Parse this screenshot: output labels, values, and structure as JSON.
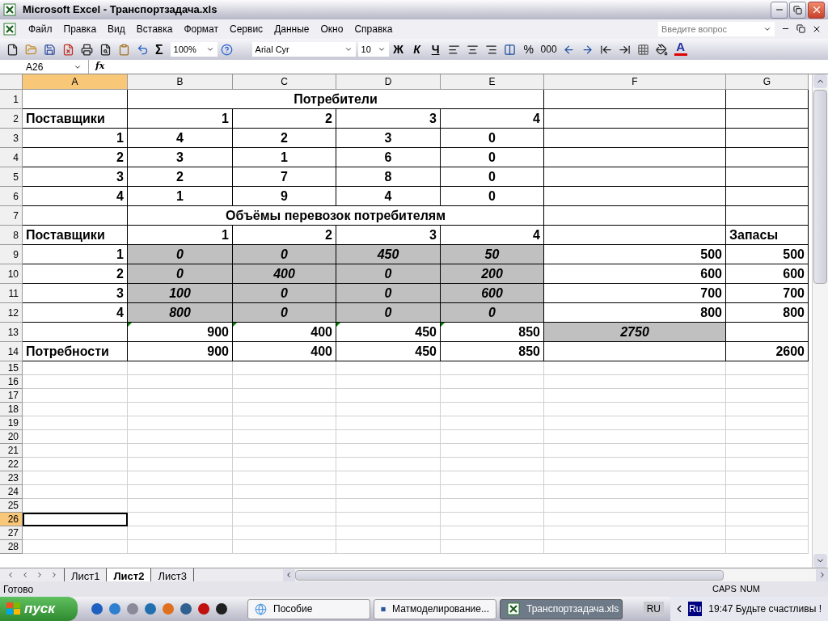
{
  "window": {
    "title": "Microsoft Excel - Транспортзадача.xls"
  },
  "menu": [
    "Файл",
    "Правка",
    "Вид",
    "Вставка",
    "Формат",
    "Сервис",
    "Данные",
    "Окно",
    "Справка"
  ],
  "help_box": {
    "placeholder": "Введите вопрос"
  },
  "toolbar": {
    "zoom": "100%",
    "sum": "Σ",
    "font": "Arial Cyr",
    "size": "10",
    "bold": "Ж",
    "italic": "К",
    "underline": "Ч",
    "percent": "%",
    "thousands": "000",
    "font_color": "A"
  },
  "formula_bar": {
    "name_box": "A26",
    "fx": "fx"
  },
  "columns": [
    {
      "label": "A",
      "selected": true
    },
    {
      "label": "B",
      "selected": false
    },
    {
      "label": "C",
      "selected": false
    },
    {
      "label": "D",
      "selected": false
    },
    {
      "label": "E",
      "selected": false
    },
    {
      "label": "F",
      "selected": false
    },
    {
      "label": "G",
      "selected": false
    }
  ],
  "rows": [
    {
      "label": "1",
      "selected": false,
      "kind": "banner",
      "cells": [
        {
          "kind": "blank"
        },
        {
          "text": "Потребители",
          "kind": "centered"
        },
        {
          "kind": "blank"
        },
        {
          "kind": "blank"
        }
      ]
    },
    {
      "label": "2",
      "selected": false,
      "kind": "table",
      "cells": [
        {
          "text": "Поставщики",
          "kind": "label"
        },
        {
          "text": "1",
          "kind": "number"
        },
        {
          "text": "2",
          "kind": "number"
        },
        {
          "text": "3",
          "kind": "number"
        },
        {
          "text": "4",
          "kind": "number"
        },
        {
          "kind": "blank"
        },
        {
          "kind": "blank"
        }
      ]
    },
    {
      "label": "3",
      "selected": false,
      "kind": "table",
      "cells": [
        {
          "text": "1",
          "kind": "number"
        },
        {
          "text": "4",
          "kind": "centered"
        },
        {
          "text": "2",
          "kind": "centered"
        },
        {
          "text": "3",
          "kind": "centered"
        },
        {
          "text": "0",
          "kind": "centered"
        },
        {
          "kind": "blank"
        },
        {
          "kind": "blank"
        }
      ]
    },
    {
      "label": "4",
      "selected": false,
      "kind": "table",
      "cells": [
        {
          "text": "2",
          "kind": "number"
        },
        {
          "text": "3",
          "kind": "centered"
        },
        {
          "text": "1",
          "kind": "centered"
        },
        {
          "text": "6",
          "kind": "centered"
        },
        {
          "text": "0",
          "kind": "centered"
        },
        {
          "kind": "blank"
        },
        {
          "kind": "blank"
        }
      ]
    },
    {
      "label": "5",
      "selected": false,
      "kind": "table",
      "cells": [
        {
          "text": "3",
          "kind": "number"
        },
        {
          "text": "2",
          "kind": "centered"
        },
        {
          "text": "7",
          "kind": "centered"
        },
        {
          "text": "8",
          "kind": "centered"
        },
        {
          "text": "0",
          "kind": "centered"
        },
        {
          "kind": "blank"
        },
        {
          "kind": "blank"
        }
      ]
    },
    {
      "label": "6",
      "selected": false,
      "kind": "table",
      "cells": [
        {
          "text": "4",
          "kind": "number"
        },
        {
          "text": "1",
          "kind": "centered"
        },
        {
          "text": "9",
          "kind": "centered"
        },
        {
          "text": "4",
          "kind": "centered"
        },
        {
          "text": "0",
          "kind": "centered"
        },
        {
          "kind": "blank"
        },
        {
          "kind": "blank"
        }
      ]
    },
    {
      "label": "7",
      "selected": false,
      "kind": "banner",
      "cells": [
        {
          "kind": "blank"
        },
        {
          "text": "Объёмы перевозок потребителям",
          "kind": "centered"
        },
        {
          "kind": "blank"
        },
        {
          "kind": "blank"
        }
      ]
    },
    {
      "label": "8",
      "selected": false,
      "kind": "table",
      "cells": [
        {
          "text": "Поставщики",
          "kind": "label"
        },
        {
          "text": "1",
          "kind": "number"
        },
        {
          "text": "2",
          "kind": "number"
        },
        {
          "text": "3",
          "kind": "number"
        },
        {
          "text": "4",
          "kind": "number"
        },
        {
          "kind": "blank"
        },
        {
          "text": "Запасы",
          "kind": "label"
        }
      ]
    },
    {
      "label": "9",
      "selected": false,
      "kind": "table",
      "cells": [
        {
          "text": "1",
          "kind": "number"
        },
        {
          "text": "0",
          "kind": "shaded"
        },
        {
          "text": "0",
          "kind": "shaded"
        },
        {
          "text": "450",
          "kind": "shaded"
        },
        {
          "text": "50",
          "kind": "shaded"
        },
        {
          "text": "500",
          "kind": "number"
        },
        {
          "text": "500",
          "kind": "number"
        }
      ]
    },
    {
      "label": "10",
      "selected": false,
      "kind": "table",
      "cells": [
        {
          "text": "2",
          "kind": "number"
        },
        {
          "text": "0",
          "kind": "shaded"
        },
        {
          "text": "400",
          "kind": "shaded"
        },
        {
          "text": "0",
          "kind": "shaded"
        },
        {
          "text": "200",
          "kind": "shaded"
        },
        {
          "text": "600",
          "kind": "number"
        },
        {
          "text": "600",
          "kind": "number"
        }
      ]
    },
    {
      "label": "11",
      "selected": false,
      "kind": "table",
      "cells": [
        {
          "text": "3",
          "kind": "number"
        },
        {
          "text": "100",
          "kind": "shaded"
        },
        {
          "text": "0",
          "kind": "shaded"
        },
        {
          "text": "0",
          "kind": "shaded"
        },
        {
          "text": "600",
          "kind": "shaded"
        },
        {
          "text": "700",
          "kind": "number"
        },
        {
          "text": "700",
          "kind": "number"
        }
      ]
    },
    {
      "label": "12",
      "selected": false,
      "kind": "table",
      "cells": [
        {
          "text": "4",
          "kind": "number"
        },
        {
          "text": "800",
          "kind": "shaded"
        },
        {
          "text": "0",
          "kind": "shaded"
        },
        {
          "text": "0",
          "kind": "shaded"
        },
        {
          "text": "0",
          "kind": "shaded"
        },
        {
          "text": "800",
          "kind": "number"
        },
        {
          "text": "800",
          "kind": "number"
        }
      ]
    },
    {
      "label": "13",
      "selected": false,
      "kind": "table",
      "cells": [
        {
          "kind": "blank"
        },
        {
          "text": "900",
          "kind": "number",
          "error_marker": true
        },
        {
          "text": "400",
          "kind": "number",
          "error_marker": true
        },
        {
          "text": "450",
          "kind": "number",
          "error_marker": true
        },
        {
          "text": "850",
          "kind": "number",
          "error_marker": true
        },
        {
          "text": "2750",
          "kind": "shaded"
        },
        {
          "kind": "blank"
        }
      ]
    },
    {
      "label": "14",
      "selected": false,
      "kind": "table",
      "cells": [
        {
          "text": "Потребности",
          "kind": "label"
        },
        {
          "text": "900",
          "kind": "number"
        },
        {
          "text": "400",
          "kind": "number"
        },
        {
          "text": "450",
          "kind": "number"
        },
        {
          "text": "850",
          "kind": "number"
        },
        {
          "kind": "blank"
        },
        {
          "text": "2600",
          "kind": "number"
        }
      ]
    },
    {
      "label": "15",
      "selected": false,
      "kind": "empty"
    },
    {
      "label": "16",
      "selected": false,
      "kind": "empty"
    },
    {
      "label": "17",
      "selected": false,
      "kind": "empty"
    },
    {
      "label": "18",
      "selected": false,
      "kind": "empty"
    },
    {
      "label": "19",
      "selected": false,
      "kind": "empty"
    },
    {
      "label": "20",
      "selected": false,
      "kind": "empty"
    },
    {
      "label": "21",
      "selected": false,
      "kind": "empty"
    },
    {
      "label": "22",
      "selected": false,
      "kind": "empty"
    },
    {
      "label": "23",
      "selected": false,
      "kind": "empty"
    },
    {
      "label": "24",
      "selected": false,
      "kind": "empty"
    },
    {
      "label": "25",
      "selected": false,
      "kind": "empty"
    },
    {
      "label": "26",
      "selected": true,
      "kind": "empty"
    },
    {
      "label": "27",
      "selected": false,
      "kind": "empty"
    },
    {
      "label": "28",
      "selected": false,
      "kind": "empty"
    }
  ],
  "sheet_tabs": [
    {
      "label": "Лист1",
      "selected": false
    },
    {
      "label": "Лист2",
      "selected": true
    },
    {
      "label": "Лист3",
      "selected": false
    }
  ],
  "status_bar": {
    "text": "Готово",
    "indicators": [
      "CAPS",
      "NUM"
    ]
  },
  "taskbar": {
    "start": "пуск",
    "windows": [
      {
        "label": "Пособие",
        "selected": false,
        "kind": "web"
      },
      {
        "label": "Матмоделирование...",
        "selected": false,
        "kind": "word"
      },
      {
        "label": "Транспортзадача.xls",
        "selected": true,
        "kind": "excel"
      }
    ],
    "language": "RU",
    "ime": "Ru",
    "clock": "19:47 Будьте счастливы !"
  }
}
